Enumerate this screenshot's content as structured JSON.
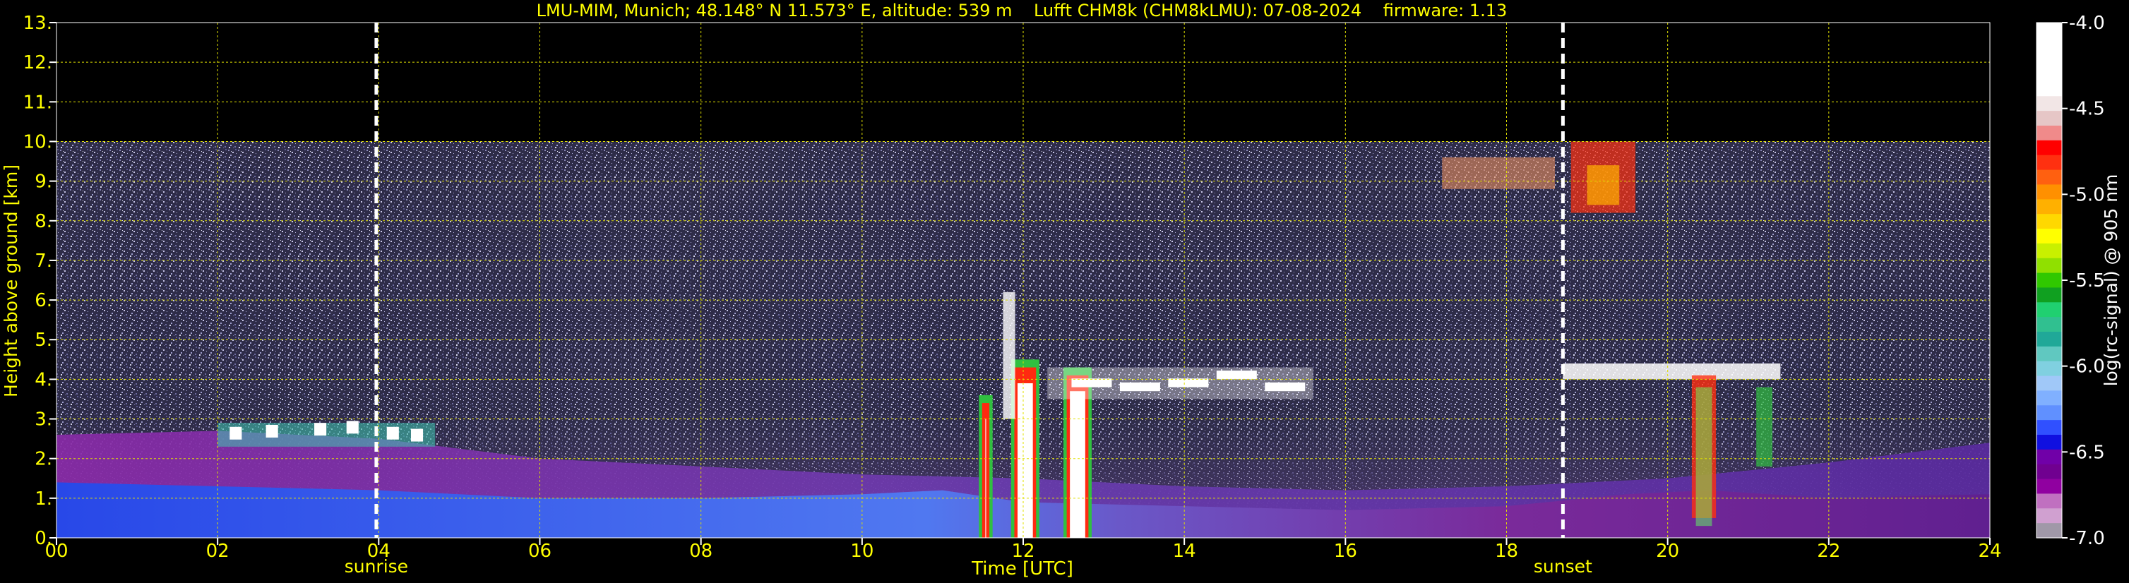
{
  "chart_data": {
    "type": "heatmap",
    "title": "LMU-MIM, Munich; 48.148° N 11.573° E, altitude: 539 m    Lufft CHM8k (CHM8kLMU): 07-08-2024    firmware: 1.13",
    "xlabel": "Time [UTC]",
    "ylabel": "Height above ground [km]",
    "xlim": [
      0,
      24
    ],
    "ylim": [
      0,
      13
    ],
    "x_ticks": [
      "00",
      "02",
      "04",
      "06",
      "08",
      "10",
      "12",
      "14",
      "16",
      "18",
      "20",
      "22",
      "24"
    ],
    "y_ticks": [
      "0.",
      "1.",
      "2.",
      "3.",
      "4.",
      "5.",
      "6.",
      "7.",
      "8.",
      "9.",
      "10.",
      "11.",
      "12.",
      "13."
    ],
    "grid": true,
    "data_top_km": 10,
    "events": [
      {
        "label": "sunrise",
        "hour": 3.97
      },
      {
        "label": "sunset",
        "hour": 18.7
      }
    ],
    "colorbar": {
      "label": "log(rc-signal) @ 905 nm",
      "range": [
        -7.0,
        -4.0
      ],
      "ticks": [
        "-4.0",
        "-4.5",
        "-5.0",
        "-5.5",
        "-6.0",
        "-6.5",
        "-7.0"
      ],
      "colors": [
        "#ffffff",
        "#ffffff",
        "#ffffff",
        "#ffffff",
        "#ffffff",
        "#f2e6e6",
        "#e6c6c6",
        "#f08a8a",
        "#ff0000",
        "#ff3010",
        "#ff6010",
        "#ff9000",
        "#ffb000",
        "#ffd800",
        "#ffff00",
        "#c8f000",
        "#90e000",
        "#30c800",
        "#10a020",
        "#20d070",
        "#30c090",
        "#20a898",
        "#60c8c0",
        "#80d0e0",
        "#a0c8f8",
        "#80b0ff",
        "#6090ff",
        "#3050ff",
        "#1010e0",
        "#7000a8",
        "#700090",
        "#9000a0",
        "#c070c0",
        "#d0a0d0",
        "#a098a8"
      ]
    },
    "features": [
      {
        "name": "surface aerosol layer",
        "start_h": 0,
        "end_h": 24,
        "top_km": 1.4
      },
      {
        "name": "boundary-layer clouds",
        "start_h": 2.0,
        "end_h": 4.7,
        "height_km": 2.6
      },
      {
        "name": "convective clouds",
        "start_h": 11.4,
        "end_h": 12.9,
        "top_km": 6.2
      },
      {
        "name": "mid-level clouds",
        "start_h": 12.3,
        "end_h": 15.6,
        "height_km": 3.9
      },
      {
        "name": "high clouds",
        "start_h": 17.2,
        "end_h": 19.6,
        "height_km": 8.9
      },
      {
        "name": "evening mid-level clouds",
        "start_h": 18.7,
        "end_h": 21.4,
        "height_km": 4.2
      }
    ]
  }
}
